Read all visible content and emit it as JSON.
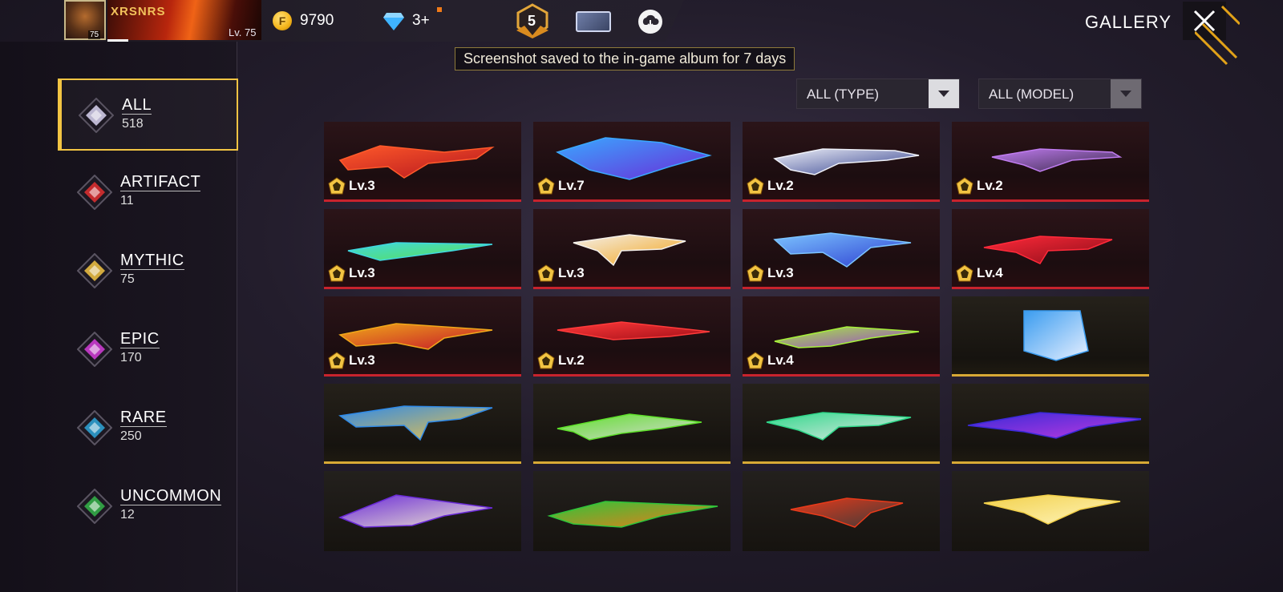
{
  "player": {
    "name": "XRSNRS",
    "level": "Lv. 75",
    "avatar_level": "75"
  },
  "currency": {
    "gold": "9790",
    "diamonds": "3+"
  },
  "rank": {
    "value": "5"
  },
  "header": {
    "title": "GALLERY"
  },
  "toast": {
    "text": "Screenshot saved to the in-game album for 7 days"
  },
  "sidebar": {
    "categories": [
      {
        "label": "ALL",
        "count": "518",
        "color": "#d8d4f0",
        "active": true
      },
      {
        "label": "ARTIFACT",
        "count": "11",
        "color": "#e23030"
      },
      {
        "label": "MYTHIC",
        "count": "75",
        "color": "#f2c443"
      },
      {
        "label": "EPIC",
        "count": "170",
        "color": "#d33ed8"
      },
      {
        "label": "RARE",
        "count": "250",
        "color": "#2fa6d8"
      },
      {
        "label": "UNCOMMON",
        "count": "12",
        "color": "#35b54a"
      }
    ]
  },
  "filters": {
    "type": "ALL (TYPE)",
    "model": "ALL (MODEL)"
  },
  "grid": {
    "tiles": [
      {
        "level": "Lv.3",
        "frame": "red",
        "c1": "#ff5a2a",
        "c2": "#b3141e"
      },
      {
        "level": "Lv.7",
        "frame": "red",
        "c1": "#3aa8ff",
        "c2": "#6a2bd8"
      },
      {
        "level": "Lv.2",
        "frame": "red",
        "c1": "#eef0f8",
        "c2": "#2c3a8a"
      },
      {
        "level": "Lv.2",
        "frame": "red",
        "c1": "#c07cf0",
        "c2": "#3a2a4a"
      },
      {
        "level": "Lv.3",
        "frame": "red",
        "c1": "#3fd8e0",
        "c2": "#5de04a"
      },
      {
        "level": "Lv.3",
        "frame": "red",
        "c1": "#f4f0ea",
        "c2": "#f2a216"
      },
      {
        "level": "Lv.3",
        "frame": "red",
        "c1": "#7cc4ff",
        "c2": "#2a3ad0"
      },
      {
        "level": "Lv.4",
        "frame": "red",
        "c1": "#ff2a3a",
        "c2": "#8a0d18"
      },
      {
        "level": "Lv.3",
        "frame": "red",
        "c1": "#f0a81a",
        "c2": "#c4142a"
      },
      {
        "level": "Lv.2",
        "frame": "red",
        "c1": "#ff3a3a",
        "c2": "#a30f18"
      },
      {
        "level": "Lv.4",
        "frame": "red",
        "c1": "#a6f03a",
        "c2": "#9a3ad8"
      },
      {
        "level": "",
        "frame": "gold",
        "c1": "#3a9cf0",
        "c2": "#e8f0ff"
      },
      {
        "level": "",
        "frame": "gold",
        "c1": "#2f8ae8",
        "c2": "#f2c443"
      },
      {
        "level": "",
        "frame": "gold",
        "c1": "#5ee02a",
        "c2": "#d8d8d8"
      },
      {
        "level": "",
        "frame": "gold",
        "c1": "#2fd88a",
        "c2": "#e8e8e8"
      },
      {
        "level": "",
        "frame": "gold",
        "c1": "#3a2ad8",
        "c2": "#c03ae0"
      },
      {
        "level": "",
        "frame": "plain",
        "c1": "#6a2ad8",
        "c2": "#f0e8d0"
      },
      {
        "level": "",
        "frame": "plain",
        "c1": "#2fc43a",
        "c2": "#f07a18"
      },
      {
        "level": "",
        "frame": "plain",
        "c1": "#e83a1a",
        "c2": "#3a3a3a"
      },
      {
        "level": "",
        "frame": "plain",
        "c1": "#f2d04a",
        "c2": "#fff6c0"
      }
    ]
  }
}
